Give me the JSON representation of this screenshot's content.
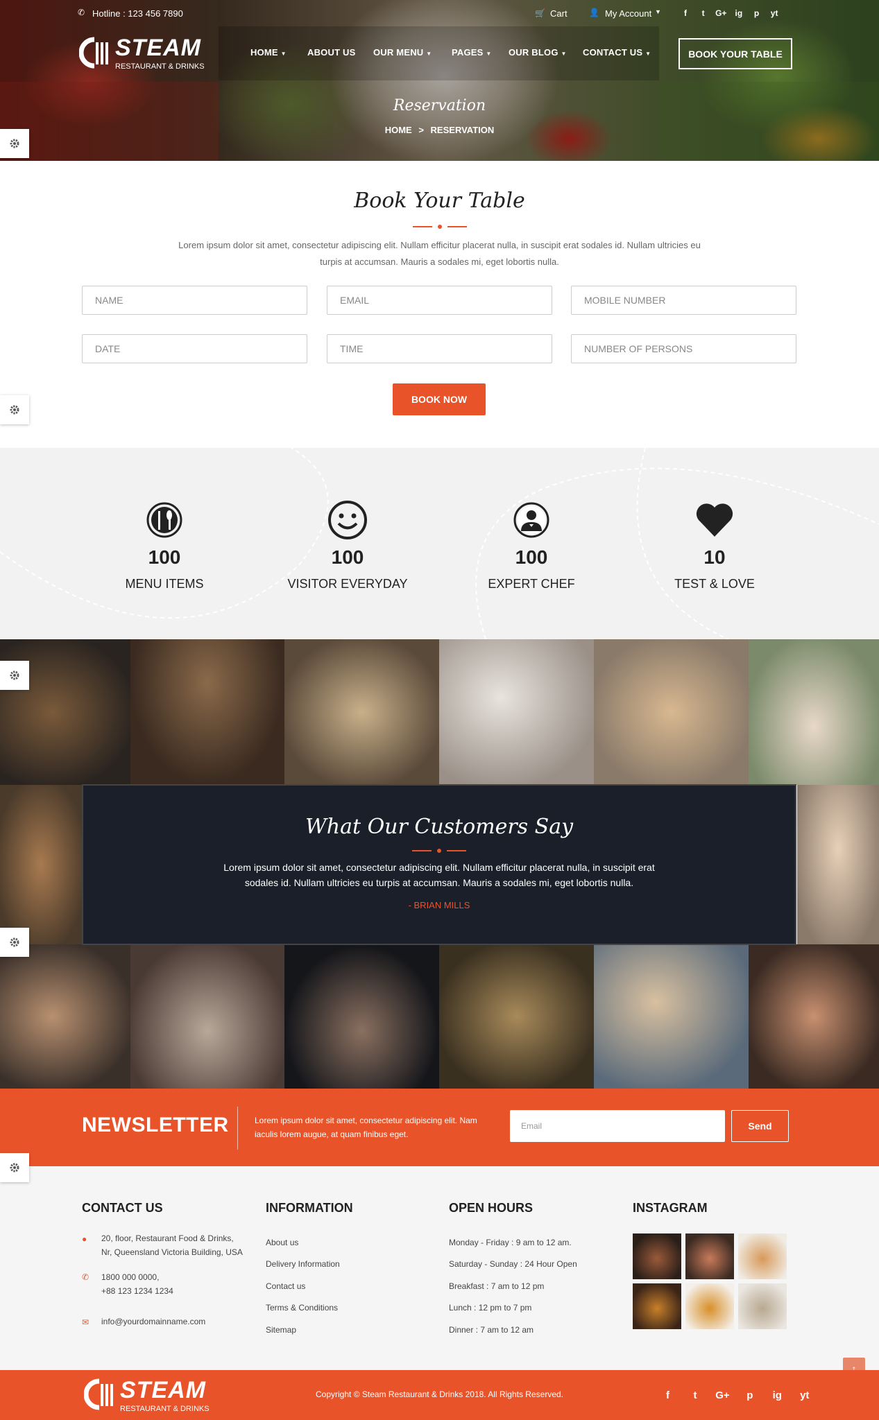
{
  "topbar": {
    "hotline": "Hotline : 123 456 7890",
    "cart": "Cart",
    "account": "My Account",
    "socials": [
      "f",
      "t",
      "G+",
      "ig",
      "p",
      "yt"
    ]
  },
  "brand": {
    "name": "STEAM",
    "tagline": "RESTAURANT & DRINKS"
  },
  "nav": {
    "items": [
      "HOME",
      "ABOUT US",
      "OUR MENU",
      "PAGES",
      "OUR BLOG",
      "CONTACT US"
    ],
    "cta": "BOOK YOUR TABLE"
  },
  "hero": {
    "title": "Reservation",
    "crumb_home": "HOME",
    "crumb_sep": ">",
    "crumb_current": "RESERVATION"
  },
  "booking": {
    "title": "Book Your Table",
    "lead_line1": "Lorem ipsum dolor sit amet, consectetur adipiscing elit. Nullam efficitur placerat nulla, in suscipit erat sodales id. Nullam ultricies eu",
    "lead_line2": "turpis at accumsan. Mauris a sodales mi, eget lobortis nulla.",
    "fields": [
      "NAME",
      "EMAIL",
      "MOBILE NUMBER",
      "DATE",
      "TIME",
      "NUMBER OF PERSONS"
    ],
    "submit": "BOOK NOW"
  },
  "stats": [
    {
      "value": "100",
      "label": "MENU ITEMS",
      "icon": "utensils-icon"
    },
    {
      "value": "100",
      "label": "VISITOR EVERYDAY",
      "icon": "smiley-icon"
    },
    {
      "value": "100",
      "label": "EXPERT CHEF",
      "icon": "chef-icon"
    },
    {
      "value": "10",
      "label": "TEST & LOVE",
      "icon": "heart-icon"
    }
  ],
  "testimonial": {
    "title": "What Our Customers Say",
    "line1": "Lorem ipsum dolor sit amet, consectetur adipiscing elit. Nullam efficitur placerat nulla, in suscipit erat",
    "line2": "sodales id. Nullam ultricies eu turpis at accumsan. Mauris a sodales mi, eget lobortis nulla.",
    "author": "- BRIAN MILLS"
  },
  "newsletter": {
    "title": "NEWSLETTER",
    "text_line1": "Lorem ipsum dolor sit amet, consectetur adipiscing elit. Nam",
    "text_line2": "iaculis lorem augue, at quam finibus eget.",
    "placeholder": "Email",
    "button": "Send"
  },
  "footer": {
    "contact": {
      "title": "CONTACT US",
      "address_line1": "20, floor, Restaurant Food & Drinks,",
      "address_line2": "Nr, Queensland Victoria Building, USA",
      "phone_line1": "1800 000 0000,",
      "phone_line2": "+88 123 1234 1234",
      "email": "info@yourdomainname.com"
    },
    "information": {
      "title": "INFORMATION",
      "links": [
        "About us",
        "Delivery Information",
        "Contact us",
        "Terms & Conditions",
        "Sitemap"
      ]
    },
    "hours": {
      "title": "OPEN HOURS",
      "lines": [
        "Monday - Friday : 9 am to 12 am.",
        "Saturday - Sunday : 24 Hour Open",
        "Breakfast : 7 am to 12 pm",
        "Lunch : 12 pm to 7 pm",
        "Dinner : 7 am to 12 am"
      ]
    },
    "instagram": {
      "title": "INSTAGRAM"
    }
  },
  "bottom": {
    "copyright": "Copyright © Steam Restaurant & Drinks 2018. All Rights Reserved.",
    "socials": [
      "f",
      "t",
      "G+",
      "p",
      "ig",
      "yt"
    ]
  },
  "colors": {
    "accent": "#e8532a",
    "dark": "#1a1f29",
    "light_bg": "#f2f2f2"
  }
}
